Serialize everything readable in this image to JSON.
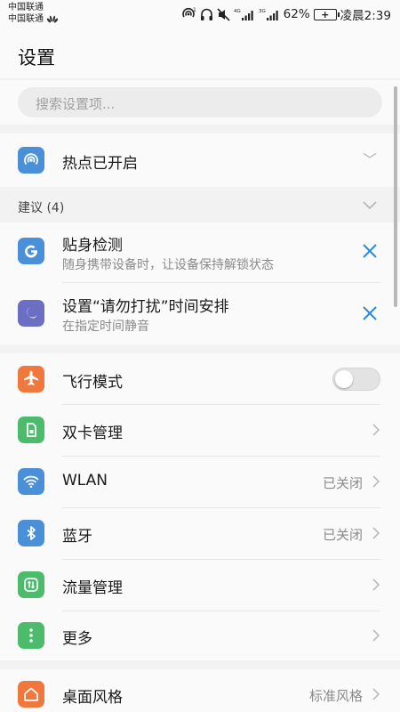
{
  "status_bar": {
    "carrier_1": "中国联通",
    "carrier_2": "中国联通",
    "network_4g": "4G",
    "network_3g": "3G",
    "battery_percent": "62%",
    "time": "凌晨2:39"
  },
  "app_bar": {
    "title": "设置"
  },
  "search": {
    "placeholder": "搜索设置项..."
  },
  "hotspot": {
    "label": "热点已开启",
    "icon": "hotspot-icon",
    "color": "#4a90d9"
  },
  "suggestions": {
    "title": "建议 (4)",
    "items": [
      {
        "label": "贴身检测",
        "sub": "随身携带设备时，让设备保持解锁状态",
        "icon": "google-g-icon",
        "color": "#4a90d9"
      },
      {
        "label": "设置“请勿打扰”时间安排",
        "sub": "在指定时间静音",
        "icon": "moon-icon",
        "color": "#6b6fc4"
      }
    ]
  },
  "main_list": [
    {
      "label": "飞行模式",
      "value": "",
      "icon": "airplane-icon",
      "color": "#f0783c",
      "control": "toggle",
      "toggle_on": false
    },
    {
      "label": "双卡管理",
      "value": "",
      "icon": "sim-card-icon",
      "color": "#4cbb6c",
      "control": "chevron"
    },
    {
      "label": "WLAN",
      "value": "已关闭",
      "icon": "wifi-icon",
      "color": "#4a90d9",
      "control": "chevron"
    },
    {
      "label": "蓝牙",
      "value": "已关闭",
      "icon": "bluetooth-icon",
      "color": "#4a90d9",
      "control": "chevron"
    },
    {
      "label": "流量管理",
      "value": "",
      "icon": "data-usage-icon",
      "color": "#4cbb6c",
      "control": "chevron"
    },
    {
      "label": "更多",
      "value": "",
      "icon": "more-icon",
      "color": "#4cbb6c",
      "control": "chevron"
    }
  ],
  "bottom_list": [
    {
      "label": "桌面风格",
      "value": "标准风格",
      "icon": "home-icon",
      "color": "#f0783c",
      "control": "chevron"
    }
  ],
  "colors": {
    "accent": "#2a8ae0",
    "background": "#f2f2f2",
    "card": "#fafafa"
  }
}
